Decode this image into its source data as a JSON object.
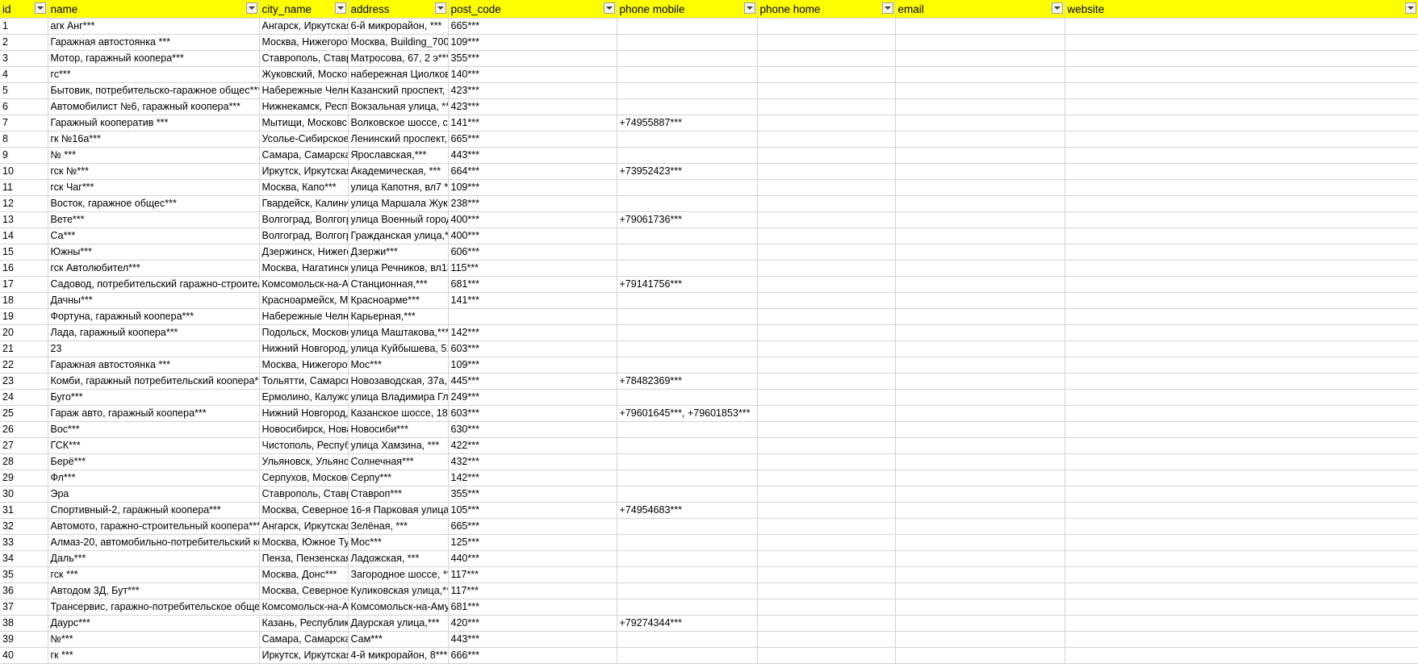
{
  "columns": [
    {
      "key": "id",
      "label": "id"
    },
    {
      "key": "name",
      "label": "name"
    },
    {
      "key": "city_name",
      "label": "city_name"
    },
    {
      "key": "address",
      "label": "address"
    },
    {
      "key": "post_code",
      "label": "post_code"
    },
    {
      "key": "phone_mobile",
      "label": "phone mobile"
    },
    {
      "key": "phone_home",
      "label": "phone home"
    },
    {
      "key": "email",
      "label": "email"
    },
    {
      "key": "website",
      "label": "website"
    }
  ],
  "rows": [
    [
      "1",
      "агк Анг***",
      "Ангарск, Иркутская",
      "6-й микрорайон, ***",
      "665***",
      "",
      "",
      "",
      ""
    ],
    [
      "2",
      "Гаражная автостоянка ***",
      "Москва, Нижегоро,",
      "Москва, Building_700:",
      "109***",
      "",
      "",
      "",
      ""
    ],
    [
      "3",
      "Мотор, гаражный коопера***",
      "Ставрополь, Ставр",
      "Матросова, 67, 2 э***",
      "355***",
      "",
      "",
      "",
      ""
    ],
    [
      "4",
      "гс***",
      "Жуковский, Моског",
      "набережная Циолков",
      "140***",
      "",
      "",
      "",
      ""
    ],
    [
      "5",
      "Бытовик, потребительско-гаражное общес***",
      "Набережные Челн",
      "Казанский проспект, :",
      "423***",
      "",
      "",
      "",
      ""
    ],
    [
      "6",
      "Автомобилист №6, гаражный коопера***",
      "Нижнекамск, Респу",
      "Вокзальная улица, **",
      "423***",
      "",
      "",
      "",
      ""
    ],
    [
      "7",
      "Гаражный кооператив ***",
      "Мытищи, Московс",
      "Волковское шоссе, ст",
      "141***",
      "+74955887***",
      "",
      "",
      ""
    ],
    [
      "8",
      "гк №16а***",
      "Усолье-Сибирское",
      "Ленинский проспект,",
      "665***",
      "",
      "",
      "",
      ""
    ],
    [
      "9",
      "№ ***",
      "Самара, Самарская",
      "Ярославская,***",
      "443***",
      "",
      "",
      "",
      ""
    ],
    [
      "10",
      "гск №***",
      "Иркутск, Иркутская",
      "Академическая, ***",
      "664***",
      "+73952423***",
      "",
      "",
      ""
    ],
    [
      "11",
      "гск Чаг***",
      "Москва, Капо***",
      "улица Капотня, вл7 **",
      "109***",
      "",
      "",
      "",
      ""
    ],
    [
      "12",
      "Восток, гаражное общес***",
      "Гвардейск, Калини",
      "улица Маршала Жукс",
      "238***",
      "",
      "",
      "",
      ""
    ],
    [
      "13",
      "Вете***",
      "Волгоград, Волгогр",
      "улица Военный город",
      "400***",
      "+79061736***",
      "",
      "",
      ""
    ],
    [
      "14",
      "Са***",
      "Волгоград, Волгогр",
      "Гражданская улица,*:",
      "400***",
      "",
      "",
      "",
      ""
    ],
    [
      "15",
      "Южны***",
      "Дзержинск, Нижегс",
      "Дзержи***",
      "606***",
      "",
      "",
      "",
      ""
    ],
    [
      "16",
      "гск Автолюбител***",
      "Москва, Нагатинск",
      "улица Речников, вл13",
      "115***",
      "",
      "",
      "",
      ""
    ],
    [
      "17",
      "Садовод, потребительский гаражно-строител",
      "Комсомольск-на-А",
      "Станционная,***",
      "681***",
      "+79141756***",
      "",
      "",
      ""
    ],
    [
      "18",
      "Дачны***",
      "Красноармейск, Мс",
      "Красноарме***",
      "141***",
      "",
      "",
      "",
      ""
    ],
    [
      "19",
      "Фортуна, гаражный коопера***",
      "Набережные Челн",
      "Карьерная,***",
      "",
      "",
      "",
      "",
      ""
    ],
    [
      "20",
      "Лада, гаражный коопера***",
      "Подольск, Московс",
      "улица Маштакова,***",
      "142***",
      "",
      "",
      "",
      ""
    ],
    [
      "21",
      "23",
      "Нижний Новгород,",
      "улица Куйбышева, 51",
      "603***",
      "",
      "",
      "",
      ""
    ],
    [
      "22",
      "Гаражная автостоянка ***",
      "Москва, Нижегоро,",
      "Мос***",
      "109***",
      "",
      "",
      "",
      ""
    ],
    [
      "23",
      "Комби, гаражный потребительский коопера*",
      "Тольятти, Самарска",
      "Новозаводская, 37а, 1",
      "445***",
      "+78482369***",
      "",
      "",
      ""
    ],
    [
      "24",
      "Буго***",
      "Ермолино, Калужс",
      "улица Владимира Гла",
      "249***",
      "",
      "",
      "",
      ""
    ],
    [
      "25",
      "Гараж авто, гаражный коопера***",
      "Нижний Новгород,",
      "Казанское шоссе, 18 к",
      "603***",
      "+79601645***, +79601853***",
      "",
      "",
      ""
    ],
    [
      "26",
      "Вос***",
      "Новосибирск, Нова",
      "Новосиби***",
      "630***",
      "",
      "",
      "",
      ""
    ],
    [
      "27",
      "ГСК***",
      "Чистополь, Респуб",
      "улица Хамзина, ***",
      "422***",
      "",
      "",
      "",
      ""
    ],
    [
      "28",
      "Берё***",
      "Ульяновск, Ульяно",
      "Солнечная***",
      "432***",
      "",
      "",
      "",
      ""
    ],
    [
      "29",
      "Фл***",
      "Серпухов, Москово",
      "Серпу***",
      "142***",
      "",
      "",
      "",
      ""
    ],
    [
      "30",
      "Эра",
      "Ставрополь, Ставр",
      "Ставроп***",
      "355***",
      "",
      "",
      "",
      ""
    ],
    [
      "31",
      "Спортивный-2, гаражный коопера***",
      "Москва, Северное",
      "16-я Парковая улица,",
      "105***",
      "+74954683***",
      "",
      "",
      ""
    ],
    [
      "32",
      "Автомото, гаражно-строительный коопера***",
      "Ангарск, Иркутская",
      "Зелёная, ***",
      "665***",
      "",
      "",
      "",
      ""
    ],
    [
      "33",
      "Алмаз-20, автомобильно-потребительский кс",
      "Москва, Южное Ту",
      "Мос***",
      "125***",
      "",
      "",
      "",
      ""
    ],
    [
      "34",
      "Даль***",
      "Пенза, Пензенская",
      "Ладожская, ***",
      "440***",
      "",
      "",
      "",
      ""
    ],
    [
      "35",
      "гск ***",
      "Москва, Донс***",
      "Загородное шоссе, **",
      "117***",
      "",
      "",
      "",
      ""
    ],
    [
      "36",
      "Автодом 3Д, Бут***",
      "Москва, Северное",
      "Куликовская улица,**",
      "117***",
      "",
      "",
      "",
      ""
    ],
    [
      "37",
      "Трансервис, гаражно-потребительское общес",
      "Комсомольск-на-А",
      "Комсомольск-на-Аму",
      "681***",
      "",
      "",
      "",
      ""
    ],
    [
      "38",
      "Даурс***",
      "Казань, Республика",
      "Даурская улица,***",
      "420***",
      "+79274344***",
      "",
      "",
      ""
    ],
    [
      "39",
      "№***",
      "Самара, Самарская",
      "Сам***",
      "443***",
      "",
      "",
      "",
      ""
    ],
    [
      "40",
      "гк ***",
      "Иркутск, Иркутская",
      "4-й микрорайон, 8***",
      "666***",
      "",
      "",
      "",
      ""
    ]
  ],
  "colors": {
    "header_bg": "#ffff00",
    "grid": "#d4d4d4"
  },
  "icons": {
    "filter": "filter-dropdown-icon"
  }
}
